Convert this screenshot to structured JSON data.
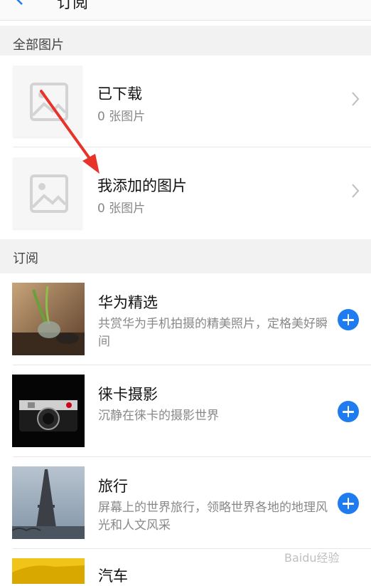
{
  "header": {
    "title": "订阅",
    "back_icon": "back-arrow-icon"
  },
  "sections": {
    "all_pictures": "全部图片",
    "subscriptions": "订阅"
  },
  "albums": [
    {
      "title": "已下载",
      "count": "0 张图片"
    },
    {
      "title": "我添加的图片",
      "count": "0 张图片"
    }
  ],
  "subscriptions": [
    {
      "title": "华为精选",
      "description": "共赏华为手机拍摄的精美照片，定格美好瞬间"
    },
    {
      "title": "徕卡摄影",
      "description": "沉静在徕卡的摄影世界"
    },
    {
      "title": "旅行",
      "description": "屏幕上的世界旅行，领略世界各地的地理风光和人文风采"
    },
    {
      "title": "汽车",
      "description": ""
    }
  ],
  "colors": {
    "accent": "#1e7cf0",
    "annotation_arrow": "#e8332a"
  },
  "watermark": "Baidu经验"
}
